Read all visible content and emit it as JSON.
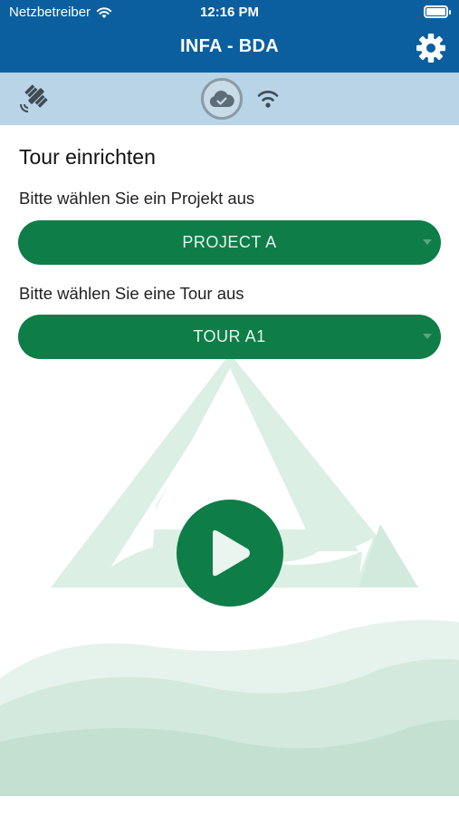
{
  "status_bar": {
    "carrier": "Netzbetreiber",
    "time": "12:16 PM",
    "battery_level": 1.0
  },
  "header": {
    "title": "INFA - BDA",
    "settings_icon": "gear-icon"
  },
  "connection_bar": {
    "gps_icon": "satellite-icon",
    "cloud_icon": "cloud-check-icon",
    "wifi_icon": "wifi-icon"
  },
  "tour_setup": {
    "title": "Tour einrichten",
    "project_prompt": "Bitte wählen Sie ein Projekt aus",
    "project_selected": "PROJECT A",
    "tour_prompt": "Bitte wählen Sie eine Tour aus",
    "tour_selected": "TOUR A1"
  },
  "actions": {
    "play_icon": "play-icon"
  },
  "colors": {
    "header": "#0b5f9e",
    "connection_bar": "#b8d4e6",
    "accent_green": "#0e7d47",
    "watermark_green": "#d6ebe0"
  }
}
